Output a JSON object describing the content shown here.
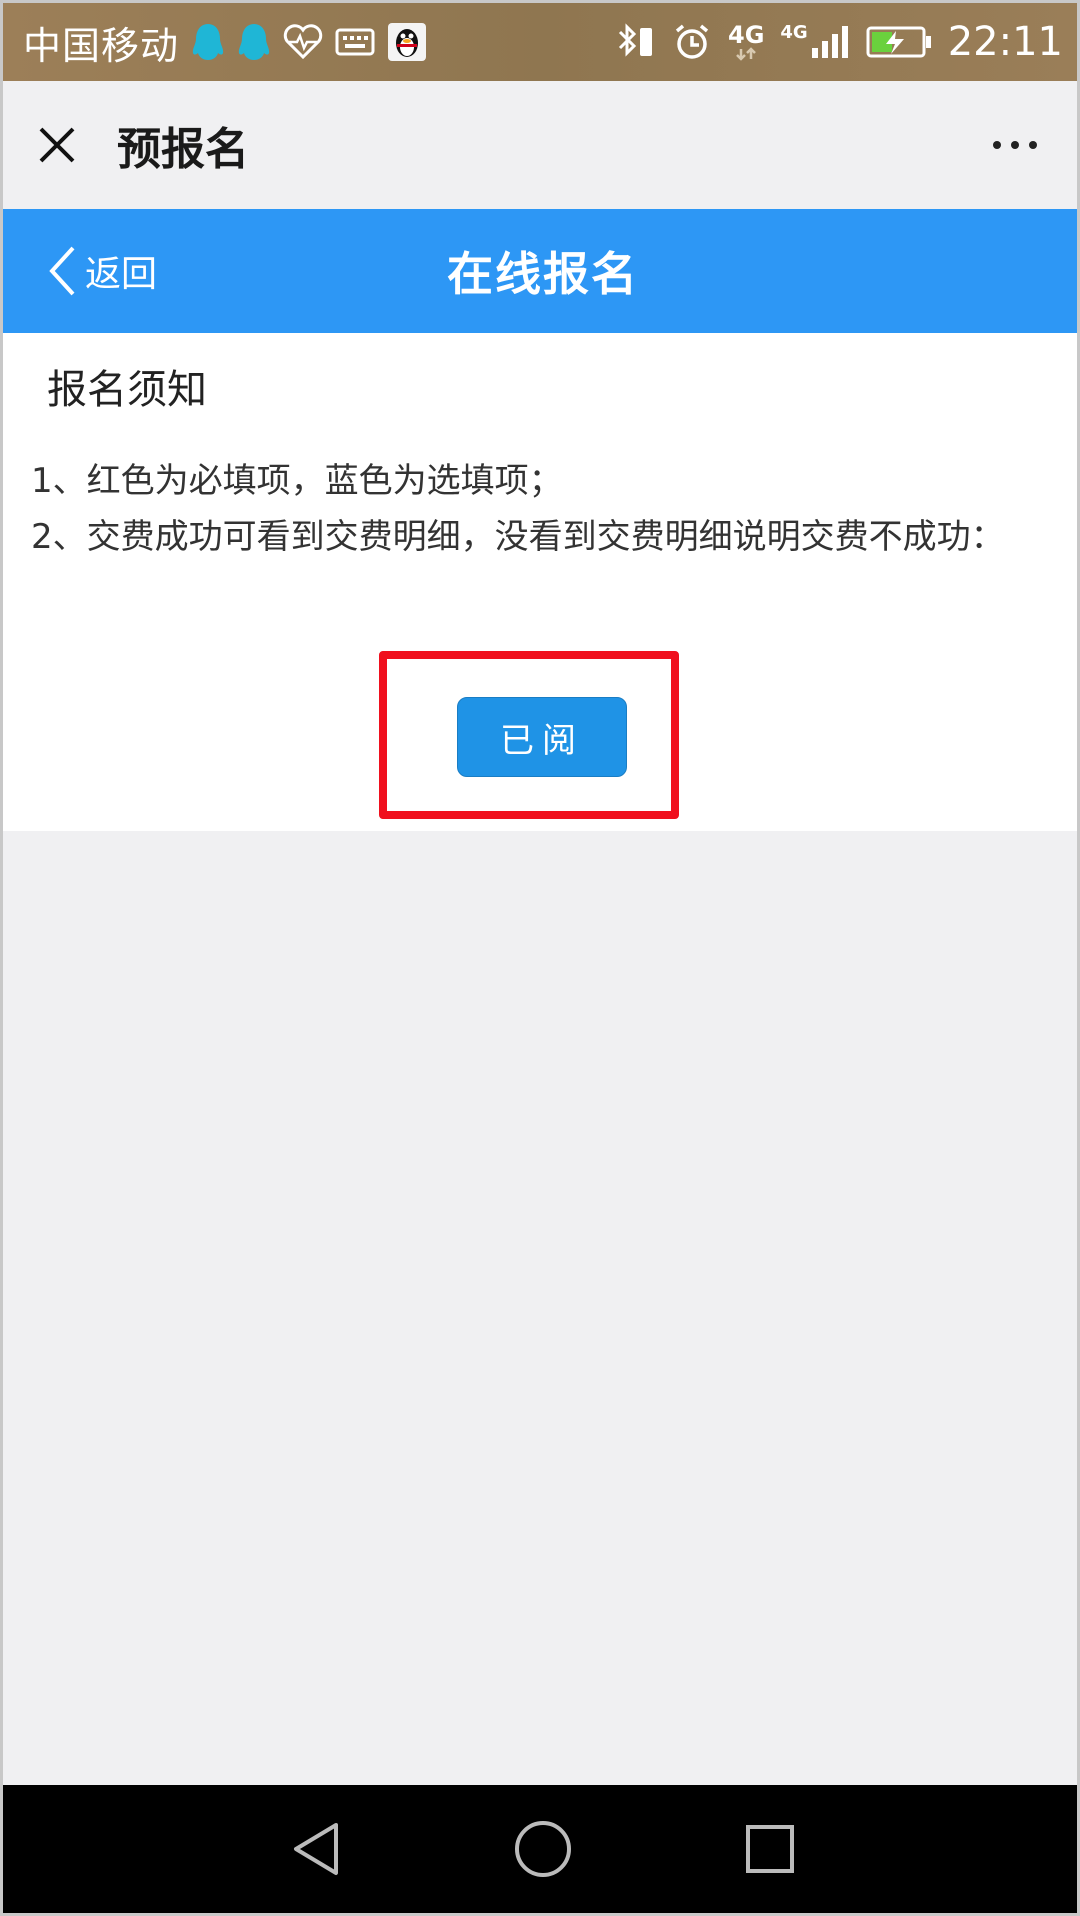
{
  "status_bar": {
    "carrier": "中国移动",
    "network_primary": "4G",
    "network_secondary": "4G",
    "time": "22:11",
    "icons": [
      "qq-notification-icon",
      "qq-notification-icon",
      "health-icon",
      "keyboard-icon",
      "qq-penguin-icon",
      "bluetooth-icon",
      "alarm-icon",
      "signal-icon",
      "battery-charging-icon"
    ]
  },
  "wechat_bar": {
    "title": "预报名"
  },
  "header": {
    "back_label": "返回",
    "title": "在线报名",
    "accent_color": "#2d97f5"
  },
  "notice": {
    "title": "报名须知",
    "line1": "1、红色为必填项，蓝色为选填项；",
    "line2": "2、交费成功可看到交费明细，没看到交费明细说明交费不成功："
  },
  "actions": {
    "read_button": "已阅"
  },
  "colors": {
    "highlight": "#f0101e",
    "button": "#1f93e6"
  }
}
